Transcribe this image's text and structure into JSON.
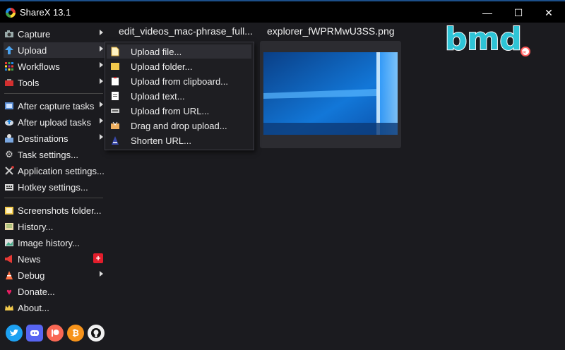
{
  "window": {
    "title": "ShareX 13.1",
    "minimize": "—",
    "maximize": "☐",
    "close": "✕"
  },
  "menu": {
    "items": [
      {
        "label": "Capture",
        "icon": "camera-icon",
        "submenu": true
      },
      {
        "label": "Upload",
        "icon": "upload-arrow-icon",
        "submenu": true,
        "selected": true
      },
      {
        "label": "Workflows",
        "icon": "workflows-grid-icon",
        "submenu": true
      },
      {
        "label": "Tools",
        "icon": "toolbox-icon",
        "submenu": true
      },
      {
        "label": "After capture tasks",
        "icon": "after-capture-icon",
        "submenu": true
      },
      {
        "label": "After upload tasks",
        "icon": "after-upload-icon",
        "submenu": true
      },
      {
        "label": "Destinations",
        "icon": "destinations-icon",
        "submenu": true
      },
      {
        "label": "Task settings...",
        "icon": "gear-icon"
      },
      {
        "label": "Application settings...",
        "icon": "wrench-icon"
      },
      {
        "label": "Hotkey settings...",
        "icon": "keyboard-icon"
      },
      {
        "label": "Screenshots folder...",
        "icon": "folder-icon"
      },
      {
        "label": "History...",
        "icon": "history-icon"
      },
      {
        "label": "Image history...",
        "icon": "image-history-icon"
      },
      {
        "label": "News",
        "icon": "megaphone-icon",
        "badge": "+"
      },
      {
        "label": "Debug",
        "icon": "debug-cone-icon",
        "submenu": true
      },
      {
        "label": "Donate...",
        "icon": "heart-icon"
      },
      {
        "label": "About...",
        "icon": "crown-icon"
      }
    ]
  },
  "upload_submenu": {
    "items": [
      {
        "label": "Upload file...",
        "icon": "file-icon"
      },
      {
        "label": "Upload folder...",
        "icon": "folder-icon"
      },
      {
        "label": "Upload from clipboard...",
        "icon": "clipboard-icon"
      },
      {
        "label": "Upload text...",
        "icon": "text-document-icon"
      },
      {
        "label": "Upload from URL...",
        "icon": "link-icon"
      },
      {
        "label": "Drag and drop upload...",
        "icon": "drop-box-icon"
      },
      {
        "label": "Shorten URL...",
        "icon": "shorten-url-icon"
      }
    ]
  },
  "thumbnails": [
    {
      "label": "edit_videos_mac-phrase_full..."
    },
    {
      "label": "explorer_fWPRMwU3SS.png"
    }
  ],
  "social": [
    "twitter-icon",
    "discord-icon",
    "patreon-icon",
    "bitcoin-icon",
    "github-icon"
  ],
  "logo": {
    "text": "bmd"
  },
  "colors": {
    "accent": "#1c4f8a",
    "badge": "#e31d2b",
    "logo": "#2ec4d6",
    "logo_dot": "#ff5a5a"
  }
}
